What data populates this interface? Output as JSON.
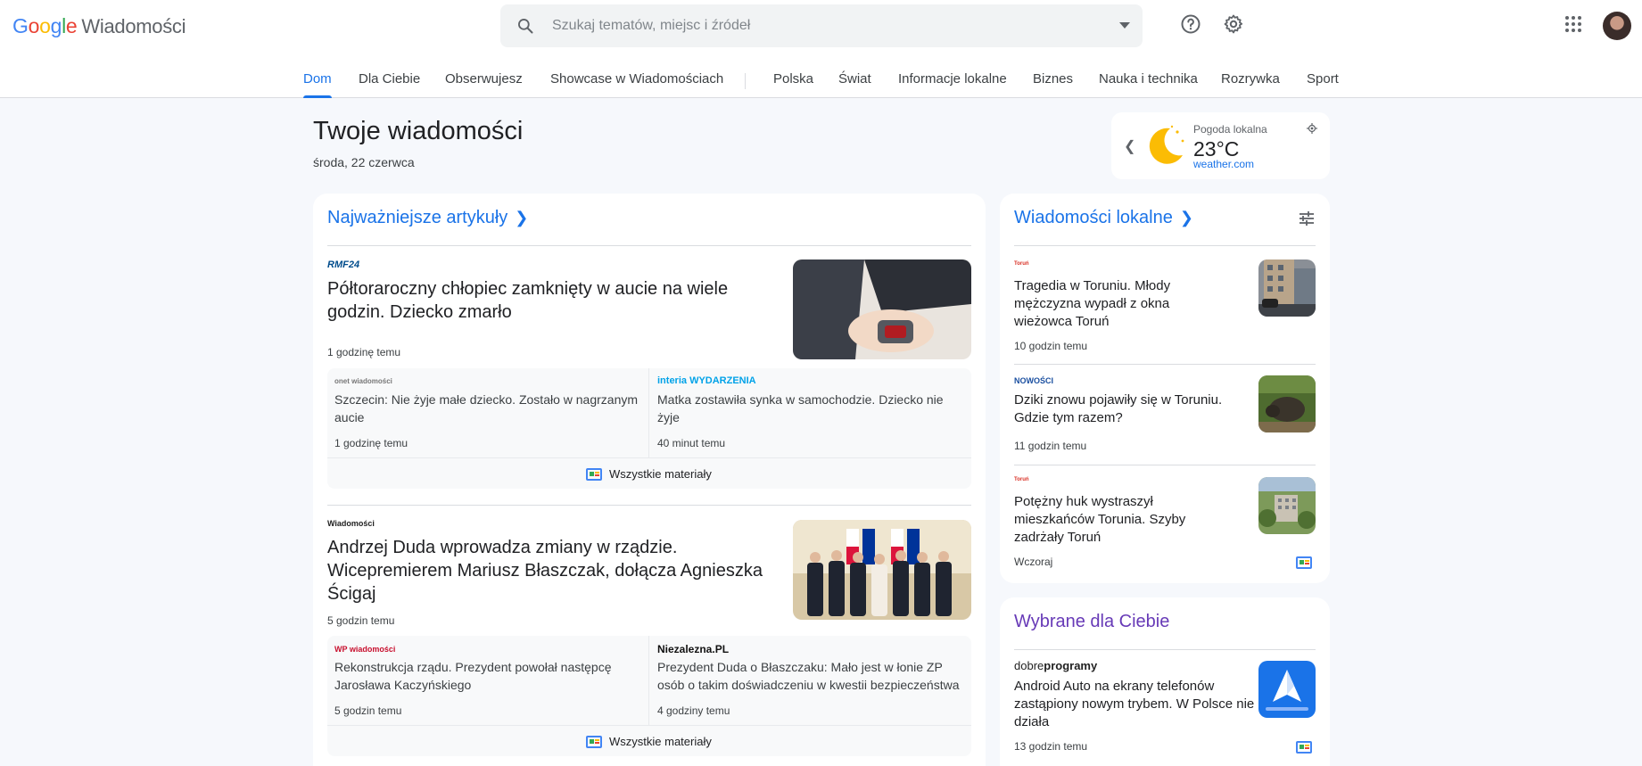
{
  "app": {
    "logo_text": "Google",
    "product": "Wiadomości"
  },
  "search": {
    "placeholder": "Szukaj tematów, miejsc i źródeł"
  },
  "header_icons": [
    "help-icon",
    "settings-icon",
    "apps-grid-icon",
    "avatar"
  ],
  "nav": {
    "items": [
      {
        "label": "Dom",
        "active": true
      },
      {
        "label": "Dla Ciebie"
      },
      {
        "label": "Obserwujesz"
      },
      {
        "label": "Showcase w Wiadomościach"
      },
      {
        "label": "Polska"
      },
      {
        "label": "Świat"
      },
      {
        "label": "Informacje lokalne"
      },
      {
        "label": "Biznes"
      },
      {
        "label": "Nauka i technika"
      },
      {
        "label": "Rozrywka"
      },
      {
        "label": "Sport"
      }
    ]
  },
  "page": {
    "title": "Twoje wiadomości",
    "date": "środa, 22 czerwca"
  },
  "weather": {
    "label": "Pogoda lokalna",
    "temp": "23°C",
    "source": "weather.com"
  },
  "top_stories": {
    "heading": "Najważniejsze artykuły",
    "stories": [
      {
        "source": "RMF24",
        "title": "Półtoraroczny chłopiec zamknięty w aucie na wiele godzin. Dziecko zmarło",
        "time": "1 godzinę temu",
        "related": [
          {
            "source": "onet wiadomości",
            "title": "Szczecin: Nie żyje małe dziecko. Zostało w nagrzanym aucie",
            "time": "1 godzinę temu"
          },
          {
            "source": "interia WYDARZENIA",
            "title": "Matka zostawiła synka w samochodzie. Dziecko nie żyje",
            "time": "40 minut temu"
          }
        ],
        "all_coverage": "Wszystkie materiały"
      },
      {
        "source": "Wiadomości",
        "title": "Andrzej Duda wprowadza zmiany w rządzie. Wicepremierem Mariusz Błaszczak, dołącza Agnieszka Ścigaj",
        "time": "5 godzin temu",
        "related": [
          {
            "source": "WP wiadomości",
            "title": "Rekonstrukcja rządu. Prezydent powołał następcę Jarosława Kaczyńskiego",
            "time": "5 godzin temu"
          },
          {
            "source": "Niezalezna.PL",
            "title": "Prezydent Duda o Błaszczaku: Mało jest w łonie ZP osób o takim doświadczeniu w kwestii bezpieczeństwa",
            "time": "4 godziny temu"
          }
        ],
        "all_coverage": "Wszystkie materiały"
      }
    ]
  },
  "local_news": {
    "heading": "Wiadomości lokalne",
    "stories": [
      {
        "source": "Toruń",
        "title": "Tragedia w Toruniu. Młody mężczyzna wypadł z okna wieżowca Toruń",
        "time": "10 godzin temu"
      },
      {
        "source": "NOWOŚCI",
        "title": "Dziki znowu pojawiły się w Toruniu. Gdzie tym razem?",
        "time": "11 godzin temu"
      },
      {
        "source": "Toruń",
        "title": "Potężny huk wystraszył mieszkańców Torunia. Szyby zadrżały Toruń",
        "time": "Wczoraj"
      }
    ]
  },
  "picks": {
    "heading": "Wybrane dla Ciebie",
    "stories": [
      {
        "source_a": "dobre",
        "source_b": "programy",
        "title": "Android Auto na ekrany telefonów zastąpiony nowym trybem. W Polsce nie działa",
        "time": "13 godzin temu"
      }
    ]
  },
  "colors": {
    "accent": "#1a73e8",
    "picks_heading": "#673ab7",
    "background": "#f6f8fc"
  }
}
